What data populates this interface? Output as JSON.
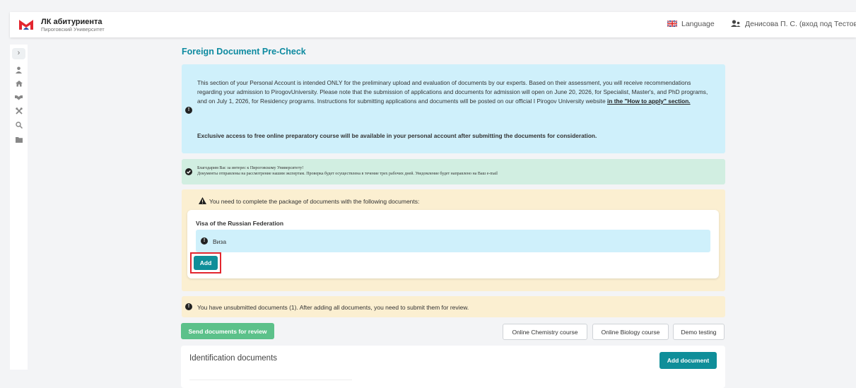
{
  "header": {
    "logo_title": "ЛК абитуриента",
    "logo_subtitle": "Пироговский Университет",
    "language_label": "Language",
    "user_label": "Денисова П. С. (вход под Тестовый Т. Т.)",
    "brand_color": "#e3262f"
  },
  "sidebar": {
    "items": [
      "chevron-right-icon",
      "user-icon",
      "home-icon",
      "handshake-icon",
      "tools-icon",
      "search-icon",
      "folder-icon"
    ]
  },
  "page": {
    "title": "Foreign Document Pre-Check"
  },
  "info": {
    "text": "This section of your Personal Account is intended ONLY for the preliminary upload and evaluation of documents by our experts. Based on their assessment, you will receive recommendations regarding your admission to PirogovUniversity. Please note that the submission of applications and documents for admission will open on June 20, 2026, for Specialist, Master's, and PhD programs, and on July 1, 2026, for Residency programs. Instructions for submitting applications and documents will be posted on our official I Pirogov University website ",
    "link": "in the \"How to apply\" section.",
    "bold": "Exclusive access to free online preparatory course will be available in your personal account after submitting the documents for consideration."
  },
  "success": {
    "line1": "Благодарим Вас за интерес к Пироговскому Университету!",
    "line2": "Документы отправлены на рассмотрение нашим экспертам. Проверка будет осуществлена в течение трех рабочих дней. Уведомление будет направлено на Ваш e-mail"
  },
  "warning": {
    "text": "You need to complete the package of documents with the following documents:",
    "card_title": "Visa of the Russian Federation",
    "card_alert": "Виза",
    "add_label": "Add"
  },
  "unsubmitted": {
    "text": "You have unsubmitted documents (1). After adding all documents, you need to submit them for review."
  },
  "actions": {
    "send_label": "Send documents for review",
    "chemistry_label": "Online Chemistry course",
    "biology_label": "Online Biology course",
    "demo_label": "Demo testing"
  },
  "docs": {
    "title": "Identification documents",
    "add_label": "Add document"
  },
  "colors": {
    "accent": "#0f8e99",
    "title": "#0d8aa0",
    "info_bg": "#cff0fb",
    "success_bg": "#d1eee1",
    "warning_bg": "#fbefd1",
    "send_button": "#5cc18a"
  }
}
